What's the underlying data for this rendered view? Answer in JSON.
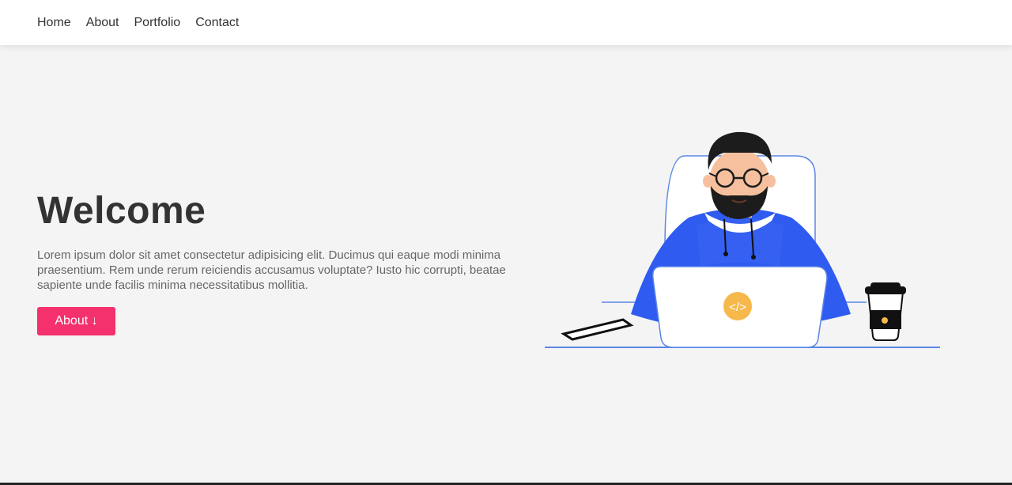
{
  "nav": {
    "items": [
      {
        "label": "Home"
      },
      {
        "label": "About"
      },
      {
        "label": "Portfolio"
      },
      {
        "label": "Contact"
      }
    ]
  },
  "hero": {
    "title": "Welcome",
    "text": "Lorem ipsum dolor sit amet consectetur adipisicing elit. Ducimus qui eaque modi minima praesentium. Rem unde rerum reiciendis accusamus voluptate? Iusto hic corrupti, beatae sapiente unde facilis minima necessitatibus mollitia.",
    "button_label": "About ↓"
  },
  "illustration": {
    "code_symbol": "</>"
  },
  "colors": {
    "accent": "#f4306d",
    "hoodie": "#2f5bf0",
    "outline": "#5b86e5",
    "laptop_badge": "#f7b84b"
  }
}
